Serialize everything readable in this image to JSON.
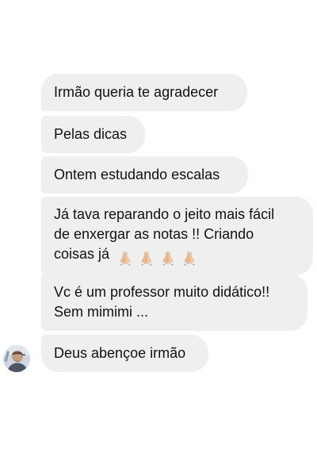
{
  "conversation": {
    "messages": [
      {
        "text": "Irmão queria te agradecer"
      },
      {
        "text": "Pelas dicas"
      },
      {
        "text": "Ontem estudando escalas"
      },
      {
        "lines": [
          "Já tava reparando o jeito mais fácil",
          "de enxergar as notas !! Criando",
          "coisas já"
        ],
        "emoji": "folded-hands",
        "emoji_count": 4
      },
      {
        "lines": [
          "Vc é um professor muito didático!!",
          "Sem mimimi ..."
        ]
      },
      {
        "text": "Deus abençoe irmão"
      }
    ]
  },
  "colors": {
    "bubble_background": "#efefef",
    "text": "#111111",
    "page_background": "#ffffff"
  }
}
